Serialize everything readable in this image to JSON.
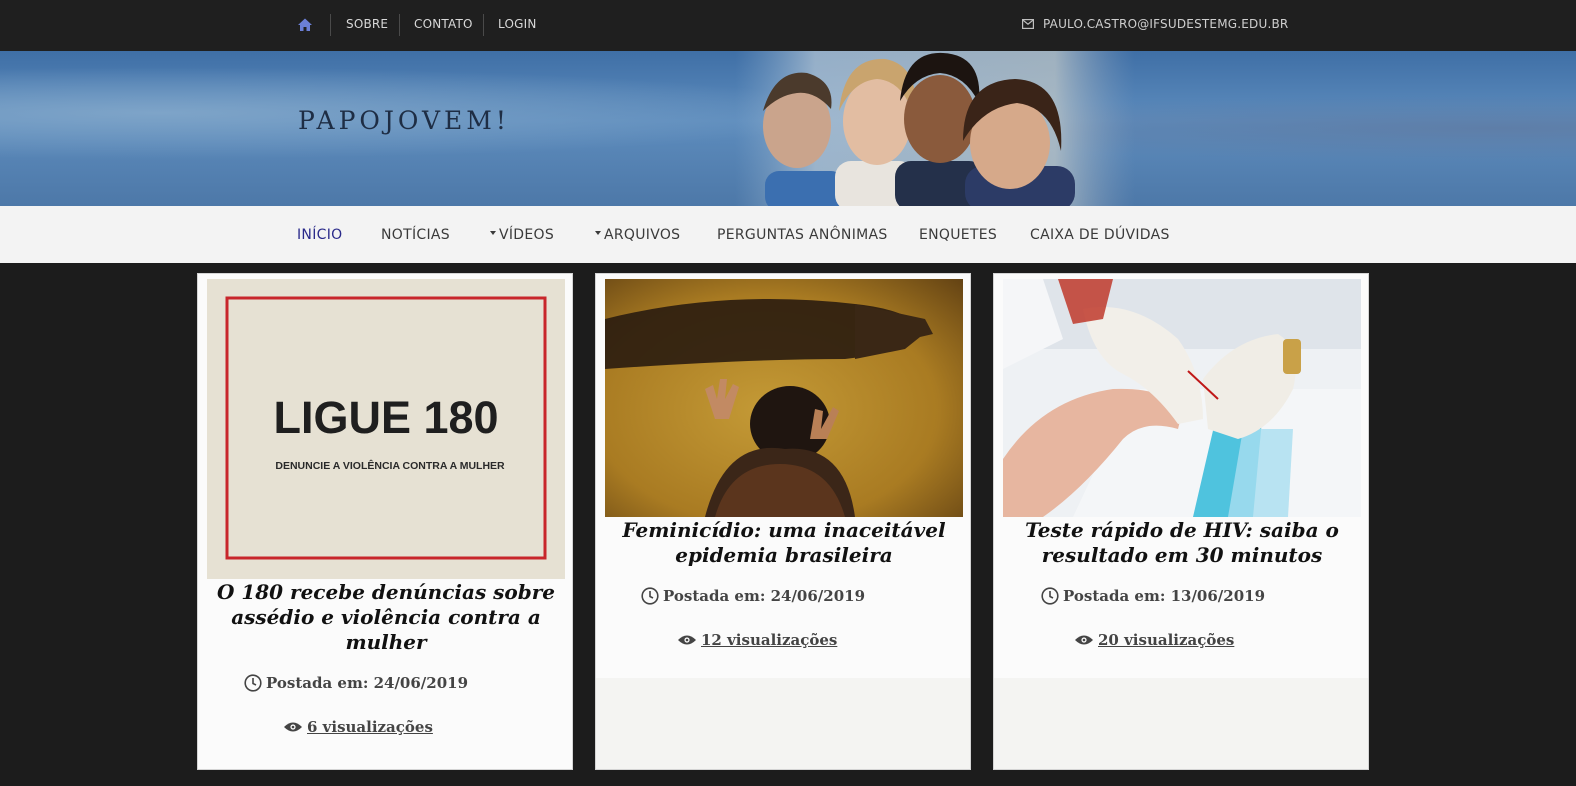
{
  "topbar": {
    "links": [
      "SOBRE",
      "CONTATO",
      "LOGIN"
    ],
    "email": "PAULO.CASTRO@IFSUDESTEMG.EDU.BR"
  },
  "banner": {
    "site_title": "PAPOJOVEM!"
  },
  "nav": {
    "items": [
      "INÍCIO",
      "NOTÍCIAS",
      "VÍDEOS",
      "ARQUIVOS",
      "PERGUNTAS ANÔNIMAS",
      "ENQUETES",
      "CAIXA DE DÚVIDAS"
    ],
    "active": "INÍCIO"
  },
  "posts": [
    {
      "title": "O 180 recebe denúncias sobre assédio e violência contra a mulher",
      "image_text": {
        "headline": "LIGUE 180",
        "subline": "DENUNCIE A VIOLÊNCIA CONTRA A MULHER"
      },
      "posted": "Postada em: 24/06/2019",
      "views": "6 visualizações"
    },
    {
      "title": "Feminicídio: uma inaceitável epidemia brasileira",
      "posted": "Postada em: 24/06/2019",
      "views": "12 visualizações"
    },
    {
      "title": "Teste rápido de HIV: saiba o resultado em 30 minutos",
      "posted": "Postada em: 13/06/2019",
      "views": "20 visualizações"
    }
  ]
}
